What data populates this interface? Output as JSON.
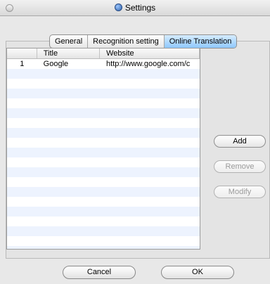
{
  "window": {
    "title": "Settings"
  },
  "tabs": [
    {
      "label": "General",
      "active": false
    },
    {
      "label": "Recognition setting",
      "active": false
    },
    {
      "label": "Online Translation",
      "active": true
    }
  ],
  "table": {
    "headers": [
      "",
      "Title",
      "Website"
    ],
    "rows": [
      {
        "index": "1",
        "title": "Google",
        "website": "http://www.google.com/c"
      },
      {
        "index": "",
        "title": "",
        "website": ""
      },
      {
        "index": "",
        "title": "",
        "website": ""
      },
      {
        "index": "",
        "title": "",
        "website": ""
      },
      {
        "index": "",
        "title": "",
        "website": ""
      },
      {
        "index": "",
        "title": "",
        "website": ""
      },
      {
        "index": "",
        "title": "",
        "website": ""
      },
      {
        "index": "",
        "title": "",
        "website": ""
      },
      {
        "index": "",
        "title": "",
        "website": ""
      },
      {
        "index": "",
        "title": "",
        "website": ""
      },
      {
        "index": "",
        "title": "",
        "website": ""
      },
      {
        "index": "",
        "title": "",
        "website": ""
      },
      {
        "index": "",
        "title": "",
        "website": ""
      },
      {
        "index": "",
        "title": "",
        "website": ""
      },
      {
        "index": "",
        "title": "",
        "website": ""
      },
      {
        "index": "",
        "title": "",
        "website": ""
      },
      {
        "index": "",
        "title": "",
        "website": ""
      },
      {
        "index": "",
        "title": "",
        "website": ""
      },
      {
        "index": "",
        "title": "",
        "website": ""
      },
      {
        "index": "",
        "title": "",
        "website": ""
      }
    ]
  },
  "side_buttons": [
    {
      "label": "Add",
      "enabled": true
    },
    {
      "label": "Remove",
      "enabled": false
    },
    {
      "label": "Modify",
      "enabled": false
    }
  ],
  "bottom_buttons": {
    "cancel": "Cancel",
    "ok": "OK"
  },
  "colors": {
    "active_tab": "#8fc8ff",
    "row_stripe": "#edf3fe"
  }
}
